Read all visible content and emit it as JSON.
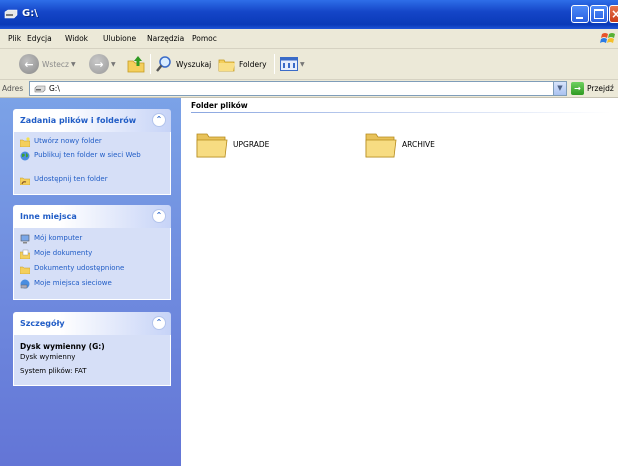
{
  "window": {
    "title": "G:\\",
    "controls": [
      "minimize",
      "maximize",
      "close"
    ]
  },
  "menu": [
    "Plik",
    "Edycja",
    "Widok",
    "Ulubione",
    "Narzędzia",
    "Pomoc"
  ],
  "toolbar": {
    "back_label": "Wstecz",
    "search_label": "Wyszukaj",
    "folders_label": "Foldery"
  },
  "address": {
    "label": "Adres",
    "value": "G:\\",
    "go_label": "Przejdź"
  },
  "left_pane": {
    "tasks_panel": {
      "title": "Zadania plików i folderów",
      "items": [
        "Utwórz nowy folder",
        "Publikuj ten folder w sieci Web",
        "Udostępnij ten folder"
      ]
    },
    "places_panel": {
      "title": "Inne miejsca",
      "items": [
        "Mój komputer",
        "Moje dokumenty",
        "Dokumenty udostępnione",
        "Moje miejsca sieciowe"
      ]
    },
    "details_panel": {
      "title": "Szczegóły",
      "name": "Dysk wymienny (G:)",
      "type": "Dysk wymienny",
      "filesystem": "System plików: FAT"
    }
  },
  "content": {
    "group_header": "Folder plików",
    "folders": [
      "UPGRADE",
      "ARCHIVE"
    ]
  },
  "colors": {
    "titlebar": "#0a3ab8",
    "task_link": "#215dc6",
    "left_pane": "#7ba2e7",
    "folder_yellow": "#f5d875"
  }
}
